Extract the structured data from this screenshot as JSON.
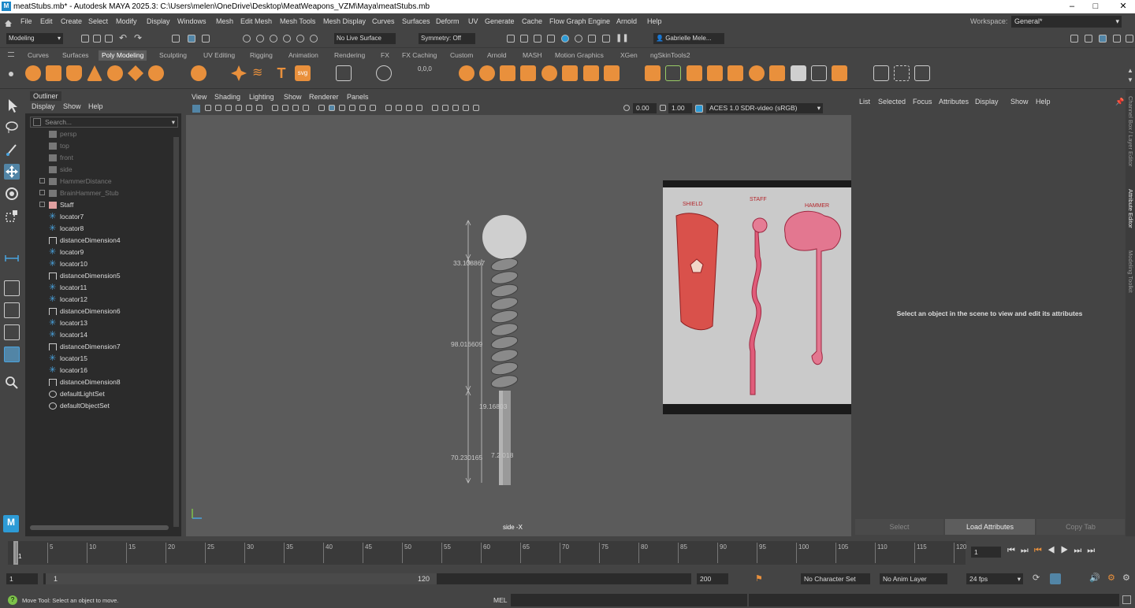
{
  "title_bar": {
    "app_icon": "M",
    "title": "meatStubs.mb* - Autodesk MAYA 2025.3: C:\\Users\\melen\\OneDrive\\Desktop\\MeatWeapons_VZM\\Maya\\meatStubs.mb",
    "minimize": "–",
    "maximize": "□",
    "close": "✕"
  },
  "menu": [
    "File",
    "Edit",
    "Create",
    "Select",
    "Modify",
    "Display",
    "Windows",
    "Mesh",
    "Edit Mesh",
    "Mesh Tools",
    "Mesh Display",
    "Curves",
    "Surfaces",
    "Deform",
    "UV",
    "Generate",
    "Cache",
    "Flow Graph Engine",
    "Arnold",
    "Help"
  ],
  "workspace": {
    "label": "Workspace:",
    "value": "General*"
  },
  "status": {
    "mode": "Modeling",
    "live_surface": "No Live Surface",
    "symmetry": "Symmetry: Off",
    "user": "Gabrielle Mele..."
  },
  "shelf_tabs": [
    "Curves",
    "Surfaces",
    "Poly Modeling",
    "Sculpting",
    "UV Editing",
    "Rigging",
    "Animation",
    "Rendering",
    "FX",
    "FX Caching",
    "Custom",
    "Arnold",
    "MASH",
    "Motion Graphics",
    "XGen",
    "ngSkinTools2"
  ],
  "active_shelf_tab": "Poly Modeling",
  "outliner": {
    "title": "Outliner",
    "menu": [
      "Display",
      "Show",
      "Help"
    ],
    "search_placeholder": "Search...",
    "items": [
      {
        "label": "persp",
        "type": "camera",
        "dim": true
      },
      {
        "label": "top",
        "type": "camera",
        "dim": true
      },
      {
        "label": "front",
        "type": "camera",
        "dim": true
      },
      {
        "label": "side",
        "type": "camera",
        "dim": true
      },
      {
        "label": "HammerDistance",
        "type": "group",
        "dim": true,
        "expand": true
      },
      {
        "label": "BrainHammer_Stub",
        "type": "group",
        "dim": true,
        "expand": true
      },
      {
        "label": "Staff",
        "type": "group",
        "dim": false,
        "expand": true
      },
      {
        "label": "locator7",
        "type": "locator"
      },
      {
        "label": "locator8",
        "type": "locator"
      },
      {
        "label": "distanceDimension4",
        "type": "dimension"
      },
      {
        "label": "locator9",
        "type": "locator"
      },
      {
        "label": "locator10",
        "type": "locator"
      },
      {
        "label": "distanceDimension5",
        "type": "dimension"
      },
      {
        "label": "locator11",
        "type": "locator"
      },
      {
        "label": "locator12",
        "type": "locator"
      },
      {
        "label": "distanceDimension6",
        "type": "dimension"
      },
      {
        "label": "locator13",
        "type": "locator"
      },
      {
        "label": "locator14",
        "type": "locator"
      },
      {
        "label": "distanceDimension7",
        "type": "dimension"
      },
      {
        "label": "locator15",
        "type": "locator"
      },
      {
        "label": "locator16",
        "type": "locator"
      },
      {
        "label": "distanceDimension8",
        "type": "dimension"
      },
      {
        "label": "defaultLightSet",
        "type": "set"
      },
      {
        "label": "defaultObjectSet",
        "type": "set"
      }
    ]
  },
  "viewport": {
    "menu": [
      "View",
      "Shading",
      "Lighting",
      "Show",
      "Renderer",
      "Panels"
    ],
    "exposure": "0.00",
    "gamma": "1.00",
    "color_space": "ACES 1.0 SDR-video (sRGB)",
    "camera_label": "side -X",
    "dimensions": [
      "33.138867",
      "98.016609",
      "19.16803",
      "70.230165",
      "7.2 018"
    ],
    "ref_labels": [
      "SHIELD",
      "STAFF",
      "HAMMER"
    ]
  },
  "attribute_editor": {
    "menu": [
      "List",
      "Selected",
      "Focus",
      "Attributes",
      "Display",
      "Show",
      "Help"
    ],
    "message": "Select an object in the scene to view and edit its attributes",
    "buttons": [
      "Select",
      "Load Attributes",
      "Copy Tab"
    ]
  },
  "side_tabs": [
    "Channel Box / Layer Editor",
    "Attribute Editor",
    "Modeling Toolkit"
  ],
  "timeline": {
    "ticks": [
      "1",
      "5",
      "10",
      "15",
      "20",
      "25",
      "30",
      "35",
      "40",
      "45",
      "50",
      "55",
      "60",
      "65",
      "70",
      "75",
      "80",
      "85",
      "90",
      "95",
      "100",
      "105",
      "110",
      "115",
      "120"
    ],
    "current_frame": "1"
  },
  "range": {
    "start": "1",
    "inner_start": "1",
    "inner_end": "120",
    "end": "200",
    "char_set": "No Character Set",
    "anim_layer": "No Anim Layer",
    "fps": "24 fps"
  },
  "command_line": {
    "help": "Move Tool: Select an object to move.",
    "lang": "MEL"
  }
}
